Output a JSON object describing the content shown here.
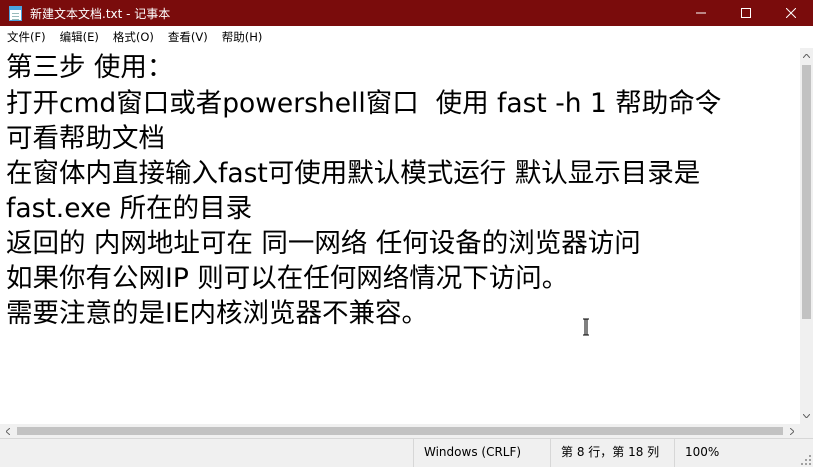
{
  "window": {
    "title": "新建文本文档.txt - 记事本",
    "colors": {
      "titlebar": "#7a0c0c",
      "text": "#000000",
      "chrome": "#f0f0f0"
    }
  },
  "titlebar_buttons": [
    {
      "name": "minimize-icon",
      "label": "minimize"
    },
    {
      "name": "maximize-icon",
      "label": "maximize"
    },
    {
      "name": "close-icon",
      "label": "close"
    }
  ],
  "menu": [
    {
      "label": "文件(F)"
    },
    {
      "label": "编辑(E)"
    },
    {
      "label": "格式(O)"
    },
    {
      "label": "查看(V)"
    },
    {
      "label": "帮助(H)"
    }
  ],
  "document": {
    "lines": [
      "第三步 使用：",
      "打开cmd窗口或者powershell窗口  使用 fast -h 1 帮助命令",
      "可看帮助文档",
      "在窗体内直接输入fast可使用默认模式运行 默认显示目录是",
      "fast.exe 所在的目录",
      "返回的 内网地址可在 同一网络 任何设备的浏览器访问",
      "如果你有公网IP 则可以在任何网络情况下访问。",
      "需要注意的是IE内核浏览器不兼容。"
    ]
  },
  "status": {
    "encoding": "Windows (CRLF)",
    "position": "第 8 行，第 18 列",
    "zoom": "100%"
  }
}
